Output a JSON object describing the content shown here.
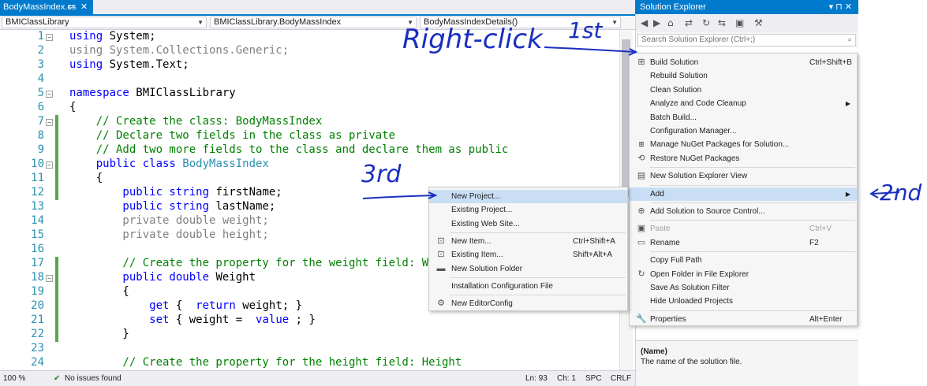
{
  "editor": {
    "tab": {
      "title": "BodyMassIndex.cs",
      "pin_glyph": "⇐",
      "close_glyph": "✕"
    },
    "nav": {
      "project": "BMIClassLibrary",
      "class": "BMIClassLibrary.BodyMassIndex",
      "member": "BodyMassIndexDetails()"
    },
    "lines": [
      {
        "n": "1",
        "segs": [
          [
            "kw",
            "using"
          ],
          [
            "",
            "System;"
          ]
        ]
      },
      {
        "n": "2",
        "segs": [
          [
            "gr",
            "using System.Collections.Generic;"
          ]
        ]
      },
      {
        "n": "3",
        "segs": [
          [
            "kw",
            "using"
          ],
          [
            "",
            "System.Text;"
          ]
        ]
      },
      {
        "n": "4",
        "segs": []
      },
      {
        "n": "5",
        "segs": [
          [
            "kw",
            "namespace"
          ],
          [
            "",
            "BMIClassLibrary"
          ]
        ]
      },
      {
        "n": "6",
        "segs": [
          [
            "",
            "{"
          ]
        ]
      },
      {
        "n": "7",
        "segs": [
          [
            "cm",
            "    // Create the class: BodyMassIndex"
          ]
        ]
      },
      {
        "n": "8",
        "segs": [
          [
            "cm",
            "    // Declare two fields in the class as private"
          ]
        ]
      },
      {
        "n": "9",
        "segs": [
          [
            "cm",
            "    // Add two more fields to the class and declare them as public"
          ]
        ]
      },
      {
        "n": "10",
        "segs": [
          [
            "kw",
            "    public class"
          ],
          [
            "ty",
            "BodyMassIndex"
          ]
        ]
      },
      {
        "n": "11",
        "segs": [
          [
            "",
            "    {"
          ]
        ]
      },
      {
        "n": "12",
        "segs": [
          [
            "kw",
            "        public string"
          ],
          [
            "",
            "firstName;"
          ]
        ]
      },
      {
        "n": "13",
        "segs": [
          [
            "kw",
            "        public string"
          ],
          [
            "",
            "lastName;"
          ]
        ]
      },
      {
        "n": "14",
        "segs": [
          [
            "gr",
            "        private double weight;"
          ]
        ]
      },
      {
        "n": "15",
        "segs": [
          [
            "gr",
            "        private double height;"
          ]
        ]
      },
      {
        "n": "16",
        "segs": []
      },
      {
        "n": "17",
        "segs": [
          [
            "cm",
            "        // Create the property for the weight field: Weig"
          ]
        ]
      },
      {
        "n": "18",
        "segs": [
          [
            "kw",
            "        public double"
          ],
          [
            "",
            "Weight"
          ]
        ]
      },
      {
        "n": "19",
        "segs": [
          [
            "",
            "        {"
          ]
        ]
      },
      {
        "n": "20",
        "segs": [
          [
            "kw",
            "            get"
          ],
          [
            "",
            "{ "
          ],
          [
            "kw",
            "return"
          ],
          [
            "",
            "weight; }"
          ]
        ]
      },
      {
        "n": "21",
        "segs": [
          [
            "kw",
            "            set"
          ],
          [
            "",
            "{ weight = "
          ],
          [
            "kw",
            "value"
          ],
          [
            "",
            "; }"
          ]
        ]
      },
      {
        "n": "22",
        "segs": [
          [
            "",
            "        }"
          ]
        ]
      },
      {
        "n": "23",
        "segs": []
      },
      {
        "n": "24",
        "segs": [
          [
            "cm",
            "        // Create the property for the height field: Height"
          ]
        ]
      }
    ]
  },
  "status": {
    "zoom": "100 %",
    "issues": "No issues found",
    "ln": "Ln: 93",
    "ch": "Ch: 1",
    "spc": "SPC",
    "crlf": "CRLF"
  },
  "solution_explorer": {
    "title": "Solution Explorer",
    "title_glyphs": "▾ ⊓ ✕",
    "search_placeholder": "Search Solution Explorer (Ctrl+;)",
    "props_name": "(Name)",
    "props_desc": "The name of the solution file."
  },
  "menu_main": [
    {
      "icon": "build-icon",
      "glyph": "⊞",
      "label": "Build Solution",
      "shortcut": "Ctrl+Shift+B"
    },
    {
      "label": "Rebuild Solution"
    },
    {
      "label": "Clean Solution"
    },
    {
      "label": "Analyze and Code Cleanup",
      "submenu": true
    },
    {
      "label": "Batch Build..."
    },
    {
      "label": "Configuration Manager..."
    },
    {
      "icon": "nuget-icon",
      "glyph": "⧆",
      "label": "Manage NuGet Packages for Solution..."
    },
    {
      "icon": "restore-icon",
      "glyph": "⟲",
      "label": "Restore NuGet Packages"
    },
    {
      "sep": true
    },
    {
      "icon": "new-view-icon",
      "glyph": "▤",
      "label": "New Solution Explorer View"
    },
    {
      "sep": true
    },
    {
      "label": "Add",
      "submenu": true,
      "selected": true
    },
    {
      "sep": true
    },
    {
      "icon": "source-control-icon",
      "glyph": "⊕",
      "label": "Add Solution to Source Control..."
    },
    {
      "sep": true
    },
    {
      "icon": "paste-icon",
      "glyph": "▣",
      "label": "Paste",
      "shortcut": "Ctrl+V",
      "disabled": true
    },
    {
      "icon": "rename-icon",
      "glyph": "▭",
      "label": "Rename",
      "shortcut": "F2"
    },
    {
      "sep": true
    },
    {
      "label": "Copy Full Path"
    },
    {
      "icon": "refresh-icon",
      "glyph": "↻",
      "label": "Open Folder in File Explorer"
    },
    {
      "label": "Save As Solution Filter"
    },
    {
      "label": "Hide Unloaded Projects"
    },
    {
      "sep": true
    },
    {
      "icon": "wrench-icon",
      "glyph": "🔧",
      "label": "Properties",
      "shortcut": "Alt+Enter"
    }
  ],
  "menu_add": [
    {
      "label": "New Project...",
      "selected": true
    },
    {
      "label": "Existing Project..."
    },
    {
      "label": "Existing Web Site..."
    },
    {
      "sep": true
    },
    {
      "icon": "new-item-icon",
      "glyph": "⊡",
      "label": "New Item...",
      "shortcut": "Ctrl+Shift+A"
    },
    {
      "icon": "existing-item-icon",
      "glyph": "⊡",
      "label": "Existing Item...",
      "shortcut": "Shift+Alt+A"
    },
    {
      "icon": "folder-icon",
      "glyph": "▬",
      "label": "New Solution Folder"
    },
    {
      "sep": true
    },
    {
      "label": "Installation Configuration File"
    },
    {
      "sep": true
    },
    {
      "icon": "editorconfig-icon",
      "glyph": "⚙",
      "label": "New EditorConfig"
    }
  ],
  "annotations": {
    "first_label": "Right-click",
    "first_step": "1st",
    "second_step": "2nd",
    "third_step": "3rd",
    "ink_color": "#1a2fbf"
  },
  "colors": {
    "accent": "#007acc",
    "keyword": "#0000ff",
    "type": "#2b91af",
    "comment": "#008000"
  }
}
